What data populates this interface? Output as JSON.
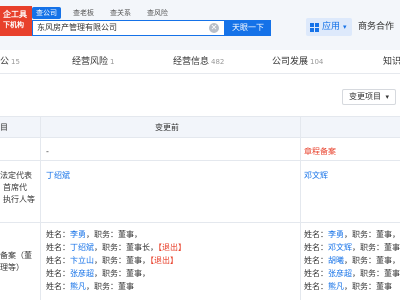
{
  "logo": {
    "line1": "企工具",
    "line2": "下机构"
  },
  "search_tabs": [
    {
      "label": "查公司",
      "active": true
    },
    {
      "label": "查老板",
      "active": false
    },
    {
      "label": "查关系",
      "active": false
    },
    {
      "label": "查风险",
      "active": false
    }
  ],
  "search": {
    "value": "东风房产管理有限公司",
    "clear_icon": "✕",
    "button": "天眼一下"
  },
  "header": {
    "app_label": "应用",
    "app_caret": "▾",
    "cooperation": "商务合作"
  },
  "categories": [
    {
      "label": "公",
      "count": "15"
    },
    {
      "label": "经营风险",
      "count": "1"
    },
    {
      "label": "经营信息",
      "count": "482"
    },
    {
      "label": "公司发展",
      "count": "104"
    },
    {
      "label": "知识",
      "count": ""
    }
  ],
  "change_filter": {
    "label": "变更项目",
    "caret": "▾"
  },
  "table": {
    "headers": [
      "目",
      "变更前"
    ],
    "row1": {
      "item": "",
      "before": "-",
      "after": "章程备案"
    },
    "row2": {
      "item_lines": [
        "法定代表",
        "首席代",
        "执行人等"
      ],
      "before": "丁绍斌",
      "after": "邓文辉"
    },
    "row3": {
      "item_lines": [
        "备案（董",
        "理等）"
      ],
      "before_lines": [
        {
          "prefix": "姓名：",
          "name": "李勇",
          "suffix": "，职务：董事，",
          "tag": ""
        },
        {
          "prefix": "姓名：",
          "name": "丁绍斌",
          "suffix": "，职务：董事长，",
          "tag": "【退出】"
        },
        {
          "prefix": "姓名：",
          "name": "卞立山",
          "suffix": "，职务：董事，",
          "tag": "【退出】"
        },
        {
          "prefix": "姓名：",
          "name": "张彦超",
          "suffix": "，职务：董事，",
          "tag": ""
        },
        {
          "prefix": "姓名：",
          "name": "熊凡",
          "suffix": "，职务：董事",
          "tag": ""
        }
      ],
      "after_lines": [
        {
          "prefix": "姓名：",
          "name": "李勇",
          "suffix": "，职务：董事，"
        },
        {
          "prefix": "姓名：",
          "name": "邓文辉",
          "suffix": "，职务：董事长"
        },
        {
          "prefix": "姓名：",
          "name": "胡曦",
          "suffix": "，职务：董事，"
        },
        {
          "prefix": "姓名：",
          "name": "张彦超",
          "suffix": "，职务：董事，"
        },
        {
          "prefix": "姓名：",
          "name": "熊凡",
          "suffix": "，职务：董事"
        }
      ]
    }
  }
}
